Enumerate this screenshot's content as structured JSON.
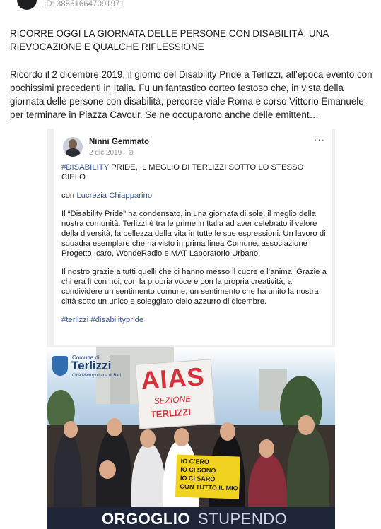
{
  "post": {
    "id_label": "ID: 385516647091971",
    "title": "RICORRE OGGI LA GIORNATA DELLE PERSONE CON DISABILITÀ: UNA RIEVOCAZIONE E QUALCHE RIFLESSIONE",
    "body": "Ricordo il 2 dicembre 2019, il giorno del Disability Pride a Terlizzi, all’epoca evento con pochissimi precedenti in Italia. Fu un fantastico corteo festoso che, in vista della giornata delle persone con disabilità, percorse viale Roma e corso Vittorio Emanuele per terminare in Piazza Cavour. Se ne occuparono anche delle emittent…"
  },
  "shared_post": {
    "author": "Ninni Gemmato",
    "date": "2 dic 2019 · ",
    "more": "···",
    "headline_tag": "#DISABILITY",
    "headline_rest": " PRIDE, IL MEGLIO DI TERLIZZI SOTTO LO STESSO CIELO",
    "with_prefix": "con ",
    "with_name": "Lucrezia Chiapparino",
    "paragraph1": "Il “Disability Pride” ha condensato, in una giornata di sole, il meglio della nostra comunità. Terlizzi è tra le prime in Italia ad aver celebrato il valore della diversità, la bellezza della vita in tutte le sue espressioni. Un lavoro di squadra esemplare che ha visto in prima linea Comune, associazione Progetto Icaro, WondeRadio e MAT Laboratorio Urbano.",
    "paragraph2": "Il nostro grazie a tutti quelli che ci hanno messo il cuore e l’anima. Grazie a chi era lì con noi, con la propria voce e con la propria creatività, a condividere un sentimento comune, un sentimento che ha unito la nostra città sotto un unico e soleggiato cielo azzurro di dicembre.",
    "hashtags": "#terlizzi #disabilitypride"
  },
  "photo": {
    "logo_small": "Comune di",
    "logo_big": "Terlizzi",
    "logo_sub": "Città Metropolitana di Bari",
    "banner_main": "AIAS",
    "banner_line2": "SEZIONE",
    "banner_line3": "TERLIZZI",
    "sign_lines": [
      "IO C'ERO",
      "IO CI SONO",
      "IO CI SARÒ",
      "CON TUTTO IL MIO"
    ],
    "footer_bold": "ORGOGLIO",
    "footer_light": "STUPENDO"
  },
  "colors": {
    "link": "#385898",
    "banner_red": "#d6313b",
    "footer_bar": "#20263a"
  }
}
